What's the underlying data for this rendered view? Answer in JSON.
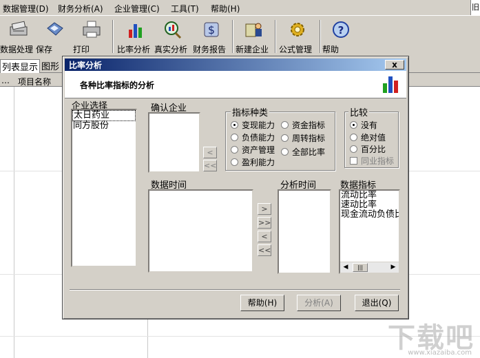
{
  "menu": [
    "数据管理(D)",
    "财务分析(A)",
    "企业管理(C)",
    "工具(T)",
    "帮助(H)"
  ],
  "toolbar": {
    "data_processing": "数据处理",
    "save": "保存",
    "print": "打印",
    "ratio_analysis": "比率分析",
    "real_analysis": "真实分析",
    "financial_report": "财务报告",
    "new_company": "新建企业",
    "formula_mgmt": "公式管理",
    "help": "帮助"
  },
  "window_restore": "旧",
  "tabs": [
    "列表显示",
    "图形"
  ],
  "grid_header": {
    "col1": "…",
    "col2": "项目名称"
  },
  "dialog": {
    "title": "比率分析",
    "close": "x",
    "header": "各种比率指标的分析",
    "company_select_label": "企业选择",
    "companies": [
      "太日药业",
      "同方股份"
    ],
    "confirm_company_label": "确认企业",
    "indicator_group": "指标种类",
    "indicators": [
      "变现能力",
      "负债能力",
      "资产管理",
      "盈利能力",
      "资金指标",
      "周转指标",
      "全部比率"
    ],
    "compare_group": "比较",
    "compare_options": [
      "没有",
      "绝对值",
      "百分比"
    ],
    "peer_checkbox": "同业指标",
    "data_time_label": "数据时间",
    "analysis_time_label": "分析时间",
    "data_indicators_label": "数据指标",
    "data_indicators": [
      "流动比率",
      "速动比率",
      "现金流动负债比"
    ],
    "btn_help": "帮助(H)",
    "btn_analyze": "分析(A)",
    "btn_exit": "退出(Q)"
  },
  "watermark": "下载吧",
  "watermark_sub": "www.xiazaiba.com"
}
